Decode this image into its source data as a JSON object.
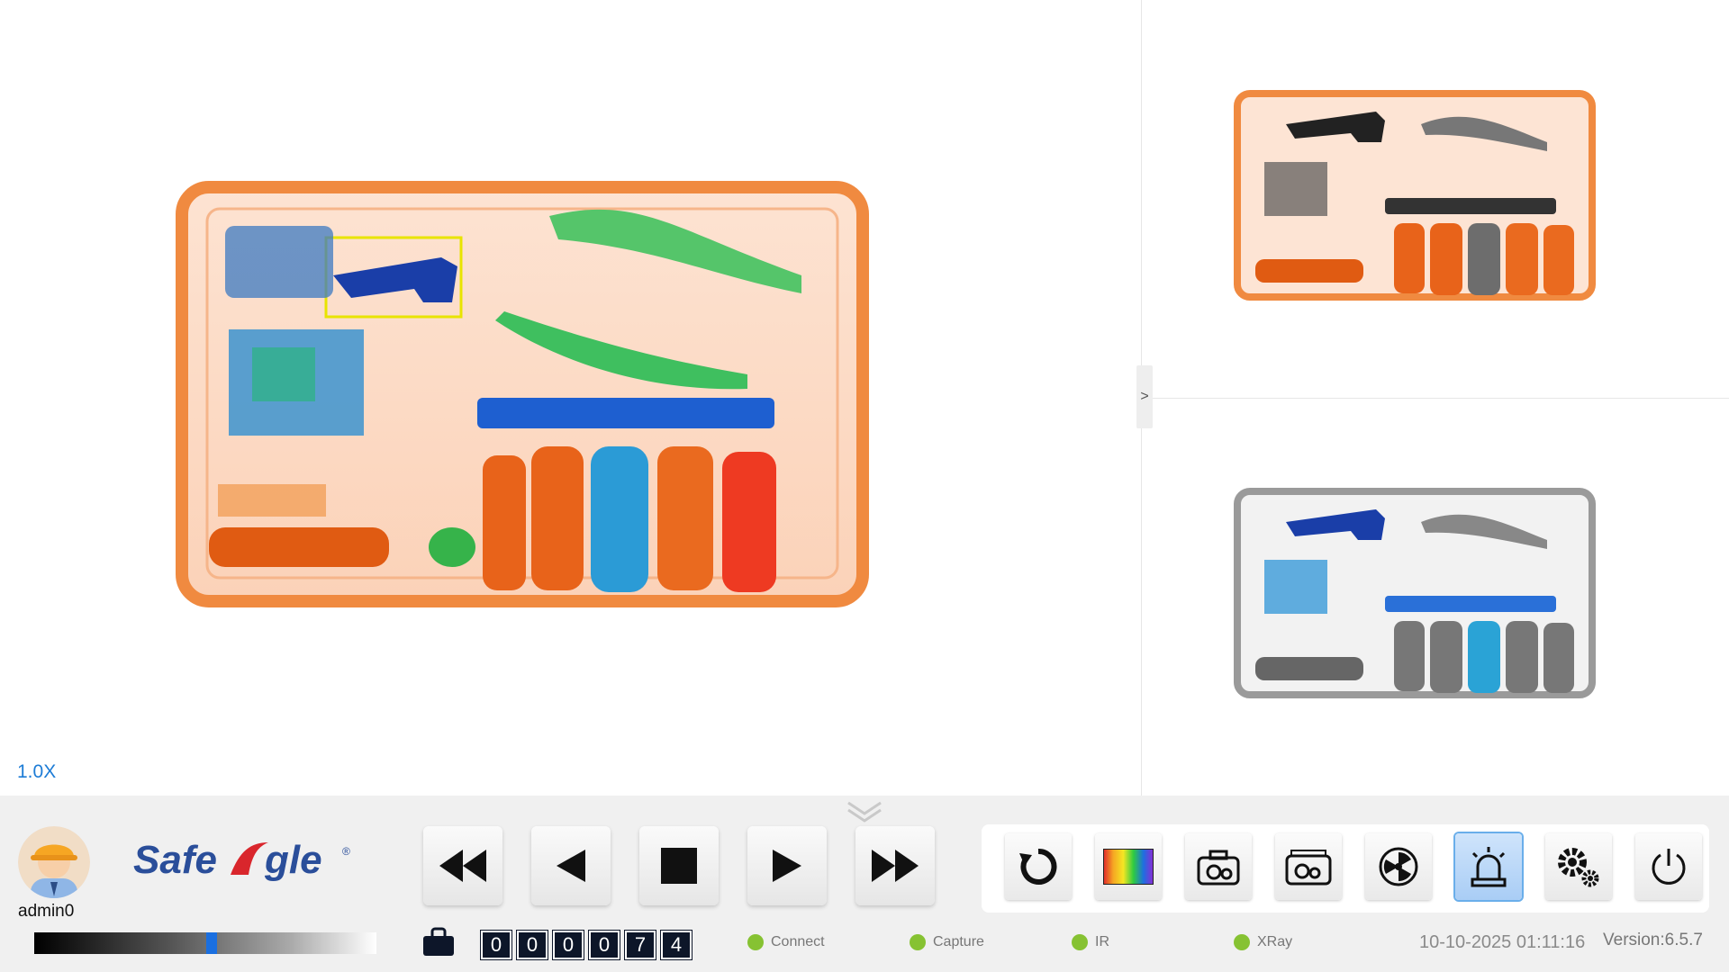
{
  "viewer": {
    "zoom_label": "1.0X",
    "collapse_toggle": ">"
  },
  "user": {
    "name": "admin0"
  },
  "brand": {
    "logo_text": "SafeAgle",
    "registered": "®"
  },
  "transport": {
    "buttons": [
      {
        "name": "fast-rewind",
        "icon": "double-left-triangle-icon"
      },
      {
        "name": "previous",
        "icon": "left-triangle-icon"
      },
      {
        "name": "stop",
        "icon": "square-stop-icon"
      },
      {
        "name": "play",
        "icon": "right-triangle-icon"
      },
      {
        "name": "fast-forward",
        "icon": "double-right-triangle-icon"
      }
    ]
  },
  "tools": {
    "buttons": [
      {
        "name": "refresh",
        "icon": "refresh-icon"
      },
      {
        "name": "color-palette",
        "icon": "rainbow-palette-icon"
      },
      {
        "name": "camera-capture",
        "icon": "camera-icon"
      },
      {
        "name": "screen-capture",
        "icon": "camera-screen-icon"
      },
      {
        "name": "radiation",
        "icon": "radiation-icon"
      },
      {
        "name": "alarm",
        "icon": "alarm-light-icon",
        "active": true
      },
      {
        "name": "settings",
        "icon": "gears-icon"
      },
      {
        "name": "power",
        "icon": "power-icon"
      }
    ]
  },
  "counter": {
    "icon": "bag-icon",
    "digits": [
      "0",
      "0",
      "0",
      "0",
      "7",
      "4"
    ]
  },
  "status": {
    "items": [
      {
        "label": "Connect",
        "color": "#86c232"
      },
      {
        "label": "Capture",
        "color": "#86c232"
      },
      {
        "label": "IR",
        "color": "#86c232"
      },
      {
        "label": "XRay",
        "color": "#86c232"
      }
    ]
  },
  "datetime": "10-10-2025 01:11:16",
  "version": "Version:6.5.7",
  "gray_scale": {
    "marker_position": 0.52
  },
  "colors": {
    "accent": "#1d7cd6",
    "active_tool": "#a9cdf5",
    "status_ok": "#86c232",
    "counter_bg": "#0d1629"
  }
}
